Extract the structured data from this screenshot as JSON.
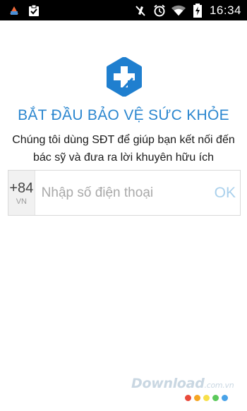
{
  "status_bar": {
    "time": "16:34",
    "icons": [
      "app-bug-icon",
      "clipboard-check-icon",
      "mute-icon",
      "alarm-icon",
      "wifi-icon",
      "battery-charging-icon"
    ]
  },
  "header": {
    "logo_icon": "medical-cross-icon",
    "title": "BẮT ĐẦU BẢO VỆ SỨC KHỎE",
    "subtitle_line1": "Chúng tôi dùng SĐT để giúp bạn kết nối đến",
    "subtitle_line2": "bác sỹ và đưa ra lời khuyên hữu ích"
  },
  "phone_form": {
    "country_code": "+84",
    "country_label": "VN",
    "phone_value": "",
    "phone_placeholder": "Nhập số điện thoại",
    "submit_label": "OK"
  },
  "watermark": {
    "text": "Download",
    "suffix": ".com.vn"
  },
  "colors": {
    "accent": "#2a86cf",
    "ok_disabled": "#a9d0ec",
    "dots": [
      "#e94b3c",
      "#f5a623",
      "#f8e04a",
      "#5cc95b",
      "#4aa3e8"
    ]
  }
}
